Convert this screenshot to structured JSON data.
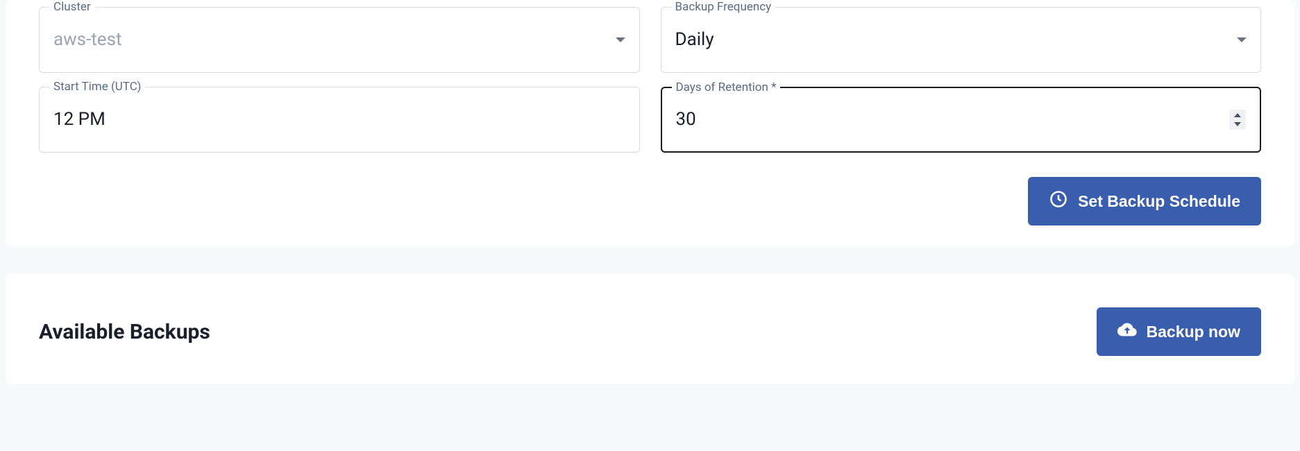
{
  "form": {
    "cluster": {
      "label": "Cluster",
      "value": "aws-test"
    },
    "backup_frequency": {
      "label": "Backup Frequency",
      "value": "Daily"
    },
    "start_time": {
      "label": "Start Time (UTC)",
      "value": "12 PM"
    },
    "days_retention": {
      "label": "Days of Retention *",
      "value": "30"
    },
    "submit_label": "Set Backup Schedule"
  },
  "available_backups": {
    "title": "Available Backups",
    "backup_now_label": "Backup now"
  },
  "colors": {
    "primary": "#3a5eae"
  }
}
